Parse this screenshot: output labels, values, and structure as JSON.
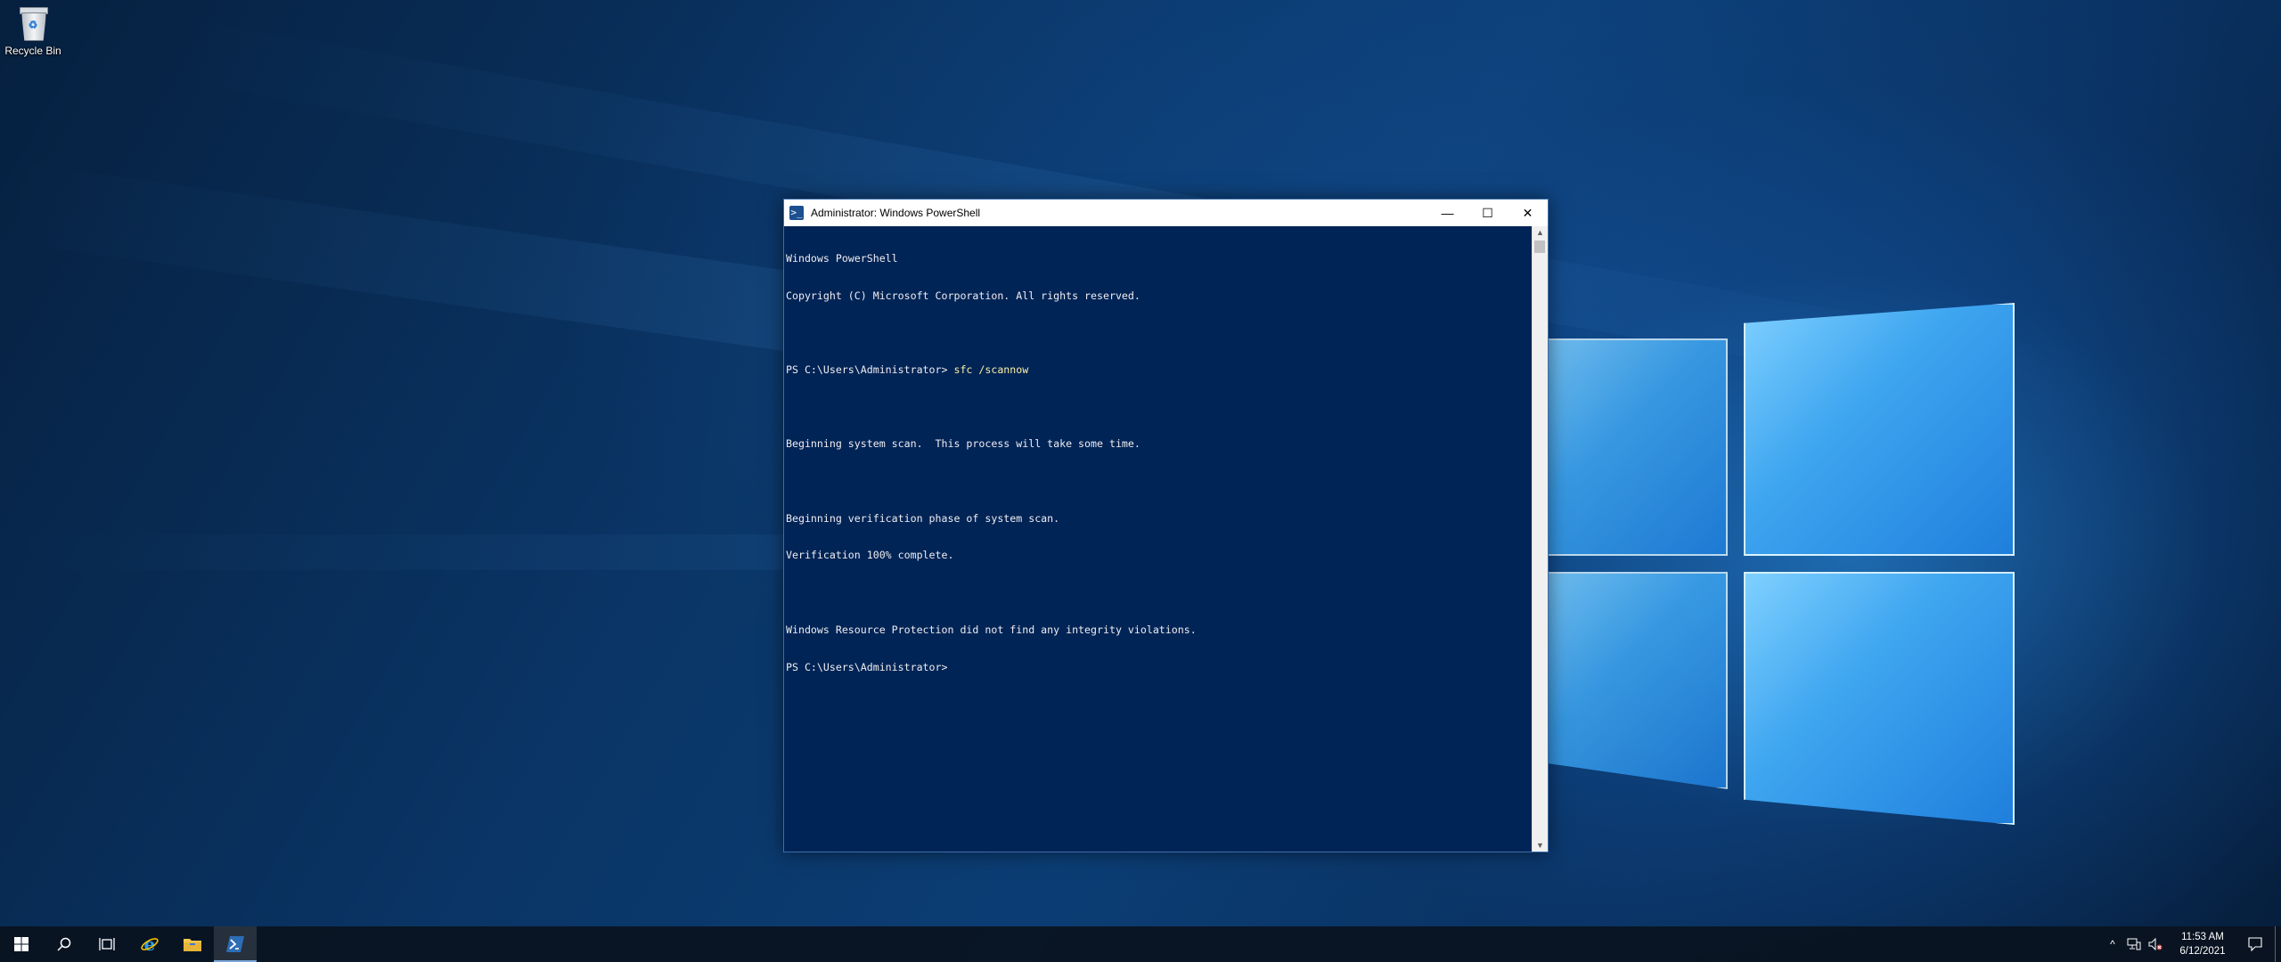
{
  "desktop": {
    "icons": [
      {
        "label": "Recycle Bin",
        "icon": "recycle-bin-icon"
      }
    ]
  },
  "window": {
    "title": "Administrator: Windows PowerShell",
    "app_icon_glyph": ">_",
    "buttons": {
      "minimize": "—",
      "maximize": "☐",
      "close": "✕"
    },
    "console_lines": [
      "Windows PowerShell",
      "Copyright (C) Microsoft Corporation. All rights reserved.",
      "",
      "PS C:\\Users\\Administrator> ",
      "",
      "Beginning system scan.  This process will take some time.",
      "",
      "Beginning verification phase of system scan.",
      "Verification 100% complete.",
      "",
      "Windows Resource Protection did not find any integrity violations.",
      "PS C:\\Users\\Administrator>"
    ],
    "command": "sfc /scannow",
    "background_color": "#012456",
    "text_color": "#eeedf0",
    "command_color": "#f9f1a5"
  },
  "taskbar": {
    "buttons": [
      {
        "name": "start-button",
        "icon": "windows-start-icon"
      },
      {
        "name": "search-button",
        "icon": "search-icon"
      },
      {
        "name": "task-view-button",
        "icon": "task-view-icon"
      },
      {
        "name": "internet-explorer-button",
        "icon": "internet-explorer-icon"
      },
      {
        "name": "file-explorer-button",
        "icon": "folder-icon"
      },
      {
        "name": "powershell-button",
        "icon": "powershell-icon",
        "active": true
      }
    ],
    "tray": {
      "icons": [
        "chevron-up-icon",
        "network-icon",
        "volume-muted-icon"
      ],
      "time": "11:53 AM",
      "date": "6/12/2021",
      "notification_icon": "notification-icon"
    }
  }
}
